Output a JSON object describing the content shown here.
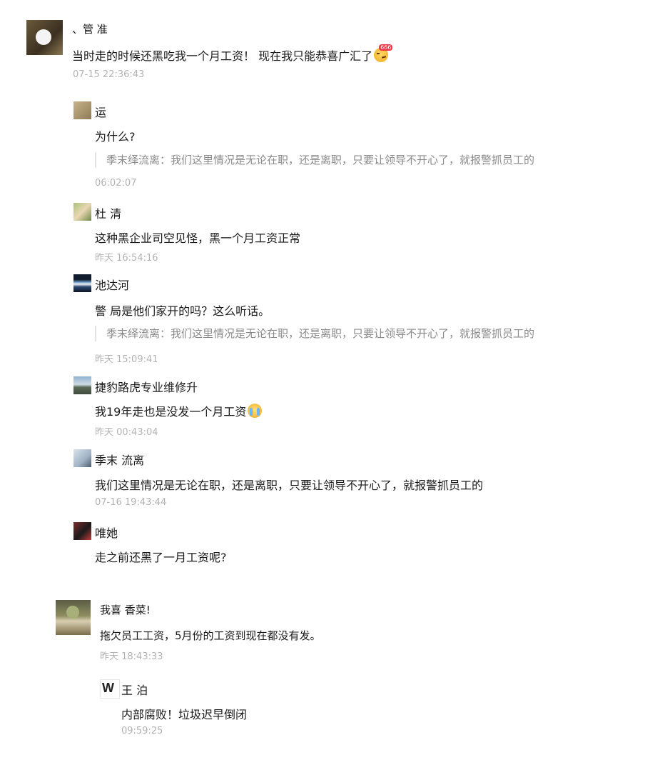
{
  "comments": [
    {
      "id": "main",
      "name": "、管 准",
      "text": "当时走的时候还黑吃我一个月工资！ 现在我只能恭喜广汇了",
      "emoji": "smirk-666-emoji",
      "time": "07-15 22:36:43"
    }
  ],
  "replies": [
    {
      "name": "运",
      "text": "为什么?",
      "quote": "季末绎流离：我们这里情况是无论在职，还是离职，只要让领导不开心了，就报警抓员工的",
      "time": "06:02:07"
    },
    {
      "name": "杜 清",
      "text": "这种黑企业司空见怪，黑一个月工资正常",
      "time": "昨天 16:54:16"
    },
    {
      "name": "池达河",
      "text": "警 局是他们家开的吗？这么听话。",
      "quote": "季末绎流离：我们这里情况是无论在职，还是离职，只要让领导不开心了，就报警抓员工的",
      "time": "昨天 15:09:41"
    },
    {
      "name": "捷豹路虎专业维修升",
      "text": "我19年走也是没发一个月工资",
      "emoji": "crying-emoji",
      "time": "昨天 00:43:04"
    },
    {
      "name": "季末 流离",
      "text": "我们这里情况是无论在职，还是离职，只要让领导不开心了，就报警抓员工的",
      "time": "07-16 19:43:44"
    },
    {
      "name": "唯她",
      "text": "走之前还黑了一月工资呢?"
    }
  ],
  "second": {
    "name": "我喜 香菜!",
    "text": "拖欠员工工资，5月份的工资到现在都没有发。",
    "time": "昨天 18:43:33",
    "reply": {
      "avatar_text": "W",
      "name": "王 泊",
      "text": "内部腐败！垃圾迟早倒闭",
      "time": "09:59:25"
    }
  }
}
